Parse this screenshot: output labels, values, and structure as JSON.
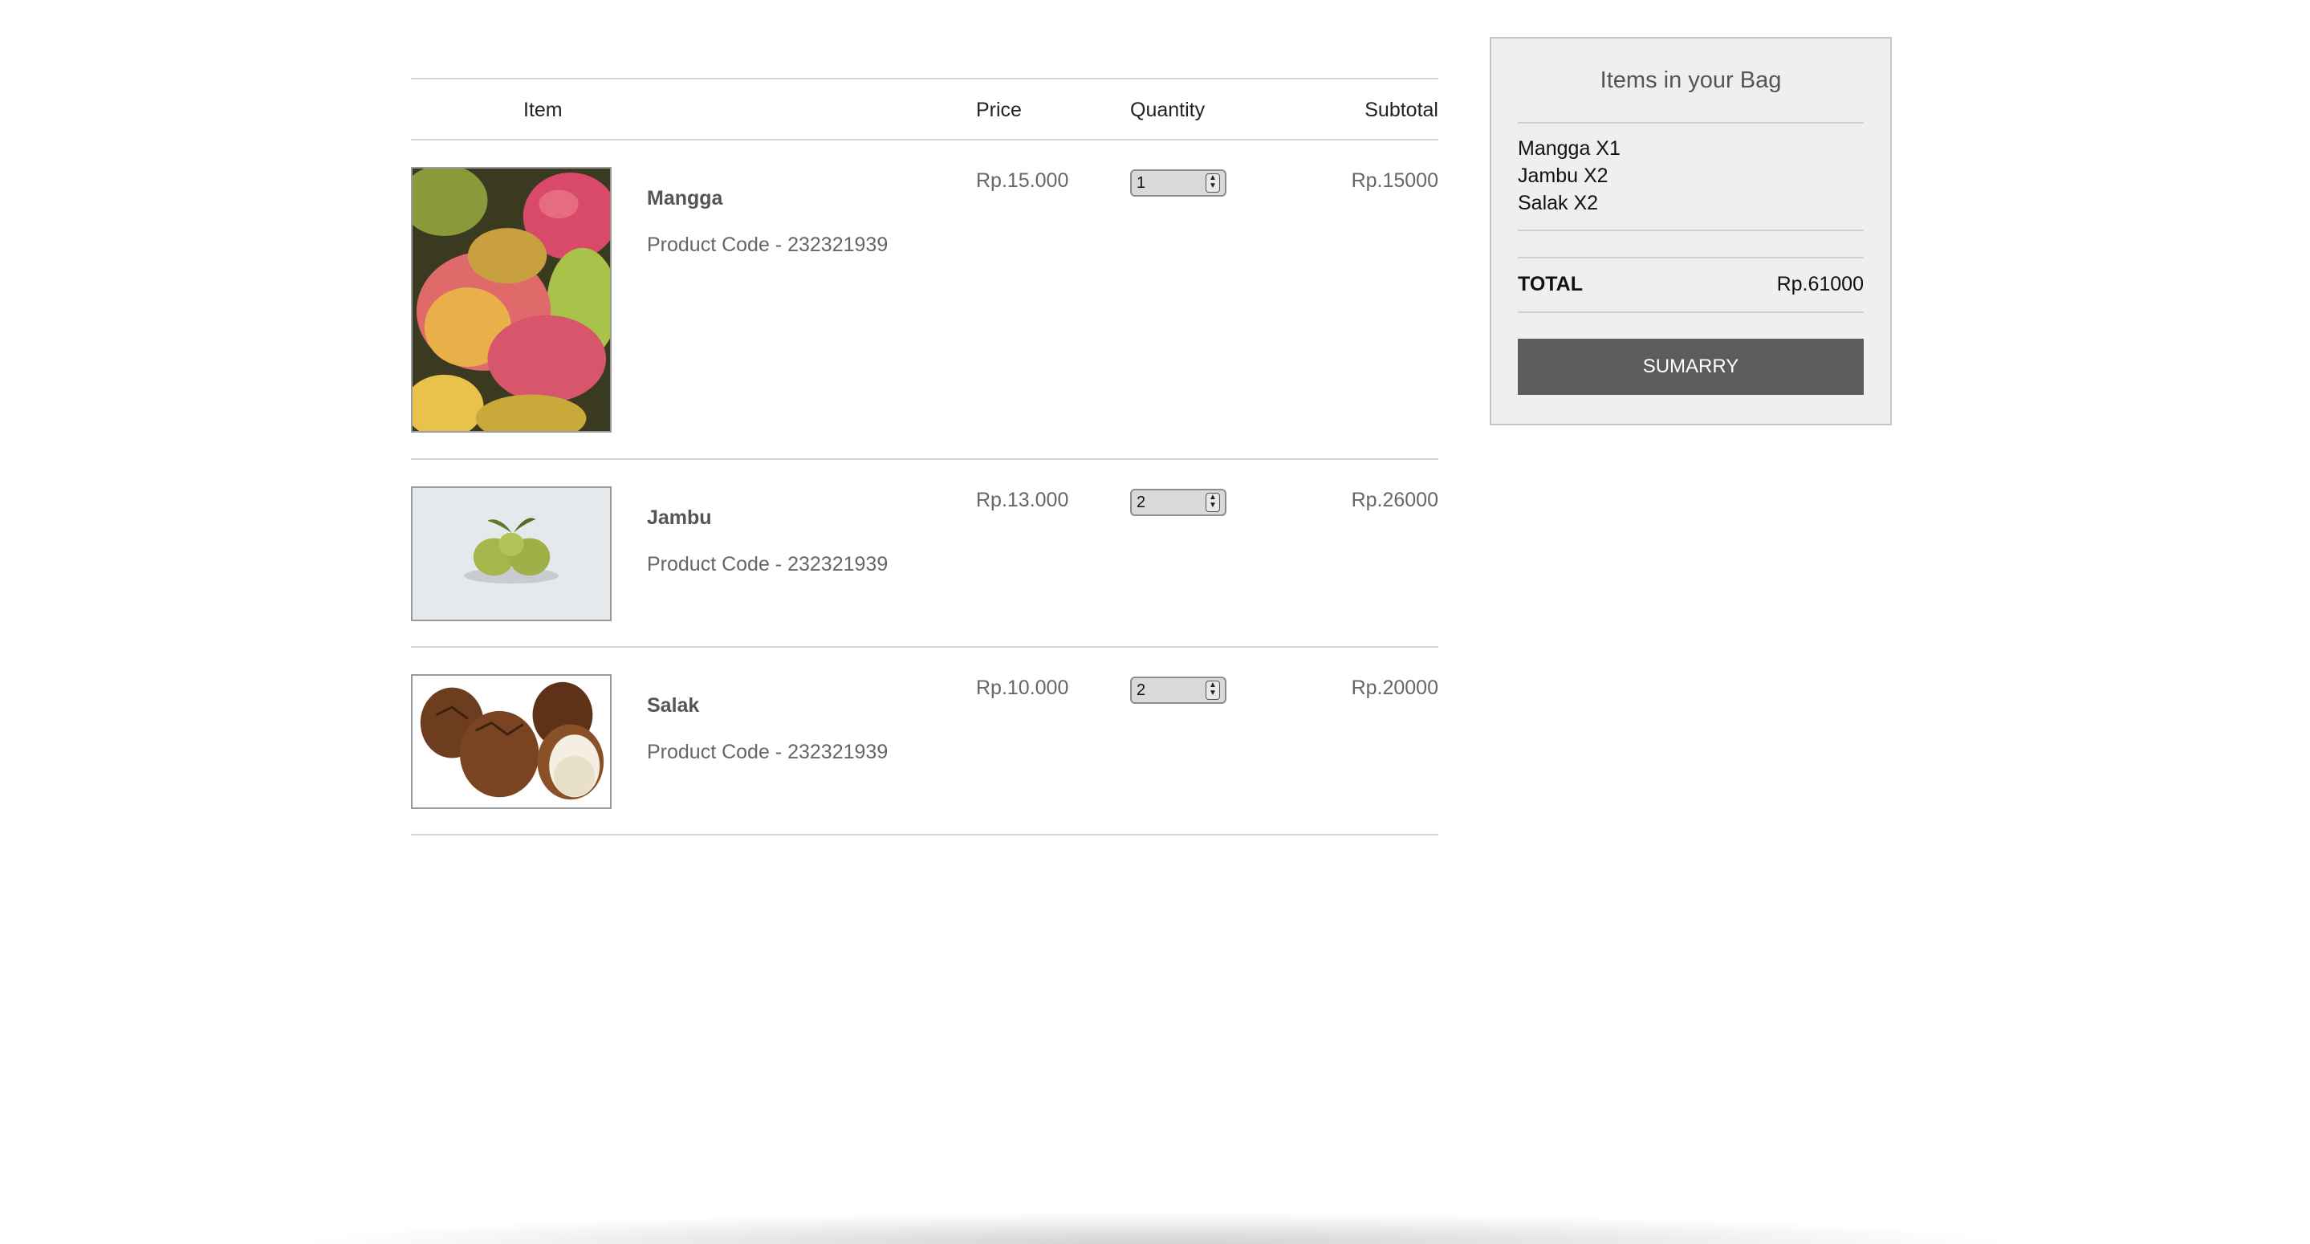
{
  "table": {
    "headers": {
      "item": "Item",
      "price": "Price",
      "quantity": "Quantity",
      "subtotal": "Subtotal"
    },
    "items": [
      {
        "name": "Mangga",
        "code": "Product Code - 232321939",
        "price": "Rp.15.000",
        "qty": "1",
        "subtotal": "Rp.15000",
        "image": "mango-image"
      },
      {
        "name": "Jambu",
        "code": "Product Code - 232321939",
        "price": "Rp.13.000",
        "qty": "2",
        "subtotal": "Rp.26000",
        "image": "guava-image"
      },
      {
        "name": "Salak",
        "code": "Product Code - 232321939",
        "price": "Rp.10.000",
        "qty": "2",
        "subtotal": "Rp.20000",
        "image": "snake-fruit-image"
      }
    ]
  },
  "bag": {
    "title": "Items in your Bag",
    "lines": [
      "Mangga  X1",
      "Jambu  X2",
      "Salak  X2"
    ],
    "total_label": "TOTAL",
    "total_value": "Rp.61000",
    "button_label": "SUMARRY"
  },
  "colors": {
    "button_bg": "#5c5c5c",
    "panel_bg": "#efefef",
    "divider": "#d6d6d6"
  }
}
